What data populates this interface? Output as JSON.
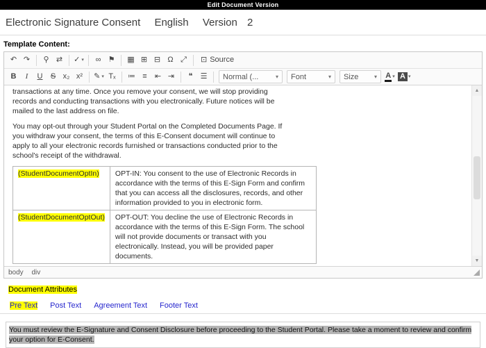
{
  "window": {
    "title": "Edit Document Version"
  },
  "header": {
    "document_name": "Electronic Signature Consent",
    "language": "English",
    "version_label": "Version",
    "version_number": "2"
  },
  "template_section": {
    "label": "Template Content:"
  },
  "editor": {
    "toolbar": {
      "row1": [
        {
          "name": "undo",
          "glyph": "↶"
        },
        {
          "name": "redo",
          "glyph": "↷"
        },
        {
          "name": "separator"
        },
        {
          "name": "find",
          "glyph": "⚲"
        },
        {
          "name": "replace",
          "glyph": "⇄"
        },
        {
          "name": "separator"
        },
        {
          "name": "spell-check",
          "glyph": "✓",
          "cls": "has-caret"
        },
        {
          "name": "separator"
        },
        {
          "name": "link",
          "glyph": "∞"
        },
        {
          "name": "anchor",
          "glyph": "⚑"
        },
        {
          "name": "separator"
        },
        {
          "name": "image",
          "glyph": "▦"
        },
        {
          "name": "table",
          "glyph": "⊞"
        },
        {
          "name": "horizontal-rule",
          "glyph": "⊟"
        },
        {
          "name": "special-character",
          "glyph": "Ω"
        },
        {
          "name": "maximize",
          "glyph": "⤢"
        },
        {
          "name": "separator"
        }
      ],
      "source_button": {
        "icon_glyph": "⊡",
        "label": "Source"
      },
      "row2": [
        {
          "name": "bold",
          "glyph": "B",
          "cls": "bold"
        },
        {
          "name": "italic",
          "glyph": "I",
          "cls": "italic"
        },
        {
          "name": "underline",
          "glyph": "U",
          "cls": "underl"
        },
        {
          "name": "strikethrough",
          "glyph": "S",
          "cls": "strike"
        },
        {
          "name": "subscript",
          "glyph": "x₂"
        },
        {
          "name": "superscript",
          "glyph": "x²"
        },
        {
          "name": "separator"
        },
        {
          "name": "copy-formatting",
          "glyph": "✎",
          "cls": "has-caret"
        },
        {
          "name": "remove-format",
          "glyph": "Tₓ"
        },
        {
          "name": "separator"
        },
        {
          "name": "numbered-list",
          "glyph": "≔"
        },
        {
          "name": "bulleted-list",
          "glyph": "≡"
        },
        {
          "name": "decrease-indent",
          "glyph": "⇤"
        },
        {
          "name": "increase-indent",
          "glyph": "⇥"
        },
        {
          "name": "separator"
        },
        {
          "name": "blockquote",
          "glyph": "❝"
        },
        {
          "name": "align-justify",
          "glyph": "☰"
        },
        {
          "name": "separator"
        }
      ],
      "format_dropdown": "Normal (...",
      "font_dropdown": "Font",
      "size_dropdown": "Size",
      "text_color": {
        "glyph": "A"
      },
      "background_color": {
        "glyph": "A"
      }
    },
    "content": {
      "paragraph1": "transactions at any time. Once you remove your consent, we will stop providing records and conducting transactions with you electronically. Future notices will be mailed to the last address on file.",
      "paragraph2": "You may opt-out through your Student Portal on the Completed Documents Page. If you withdraw your consent, the terms of this E-Consent document will continue to apply to all your electronic records furnished or transactions conducted prior to the school's receipt of the withdrawal.",
      "option_table": [
        {
          "token": "(StudentDocumentOptIn)",
          "description": "OPT-IN: You consent to the use of Electronic Records in accordance with the terms of this E-Sign Form and confirm that you can access all the disclosures, records, and other information provided to you in electronic form."
        },
        {
          "token": "(StudentDocumentOptOut)",
          "description": "OPT-OUT: You decline the use of Electronic Records in accordance with the terms of this E-Sign Form. The school will not provide documents or transact with you electronically. Instead, you will be provided paper documents."
        }
      ]
    },
    "status_bar": {
      "path": [
        "body",
        "div"
      ]
    }
  },
  "attributes_section": {
    "label": "Document Attributes",
    "tabs": [
      {
        "label": "Pre Text",
        "active": true
      },
      {
        "label": "Post Text",
        "active": false
      },
      {
        "label": "Agreement Text",
        "active": false
      },
      {
        "label": "Footer Text",
        "active": false
      }
    ],
    "pre_text_value": "You must review the E-Signature and Consent Disclosure before proceeding to the Student Portal. Please take a moment to review and confirm your option for E-Consent."
  },
  "colors": {
    "highlight_yellow": "#ffff00",
    "selection_gray": "#b5b5b5",
    "link_blue": "#2525cd",
    "titlebar_black": "#000000"
  }
}
